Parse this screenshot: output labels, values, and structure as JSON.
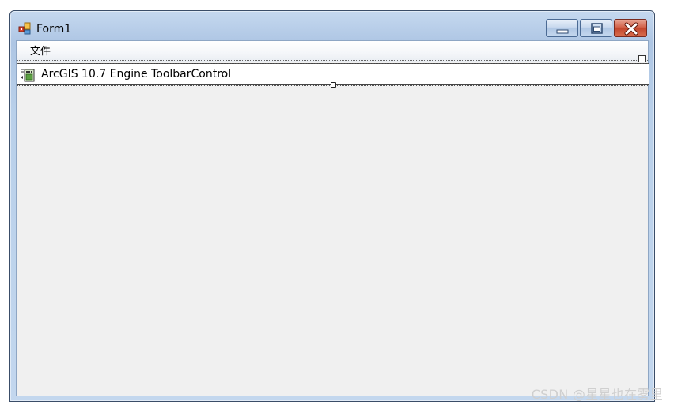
{
  "window": {
    "title": "Form1",
    "app_icon": "form-icon",
    "caption_buttons": {
      "minimize_icon": "minimize-icon",
      "maximize_icon": "maximize-icon",
      "close_icon": "close-icon"
    }
  },
  "menubar": {
    "items": [
      {
        "label": "文件"
      }
    ]
  },
  "toolbar_control": {
    "label": "ArcGIS 10.7 Engine ToolbarControl",
    "icon": "toolbar-control-icon"
  },
  "watermark": {
    "text": "CSDN @星星也在雾里"
  },
  "colors": {
    "client_background": "#f0f0f0",
    "close_button": "#c2452c",
    "frame": "#aec6e4"
  }
}
